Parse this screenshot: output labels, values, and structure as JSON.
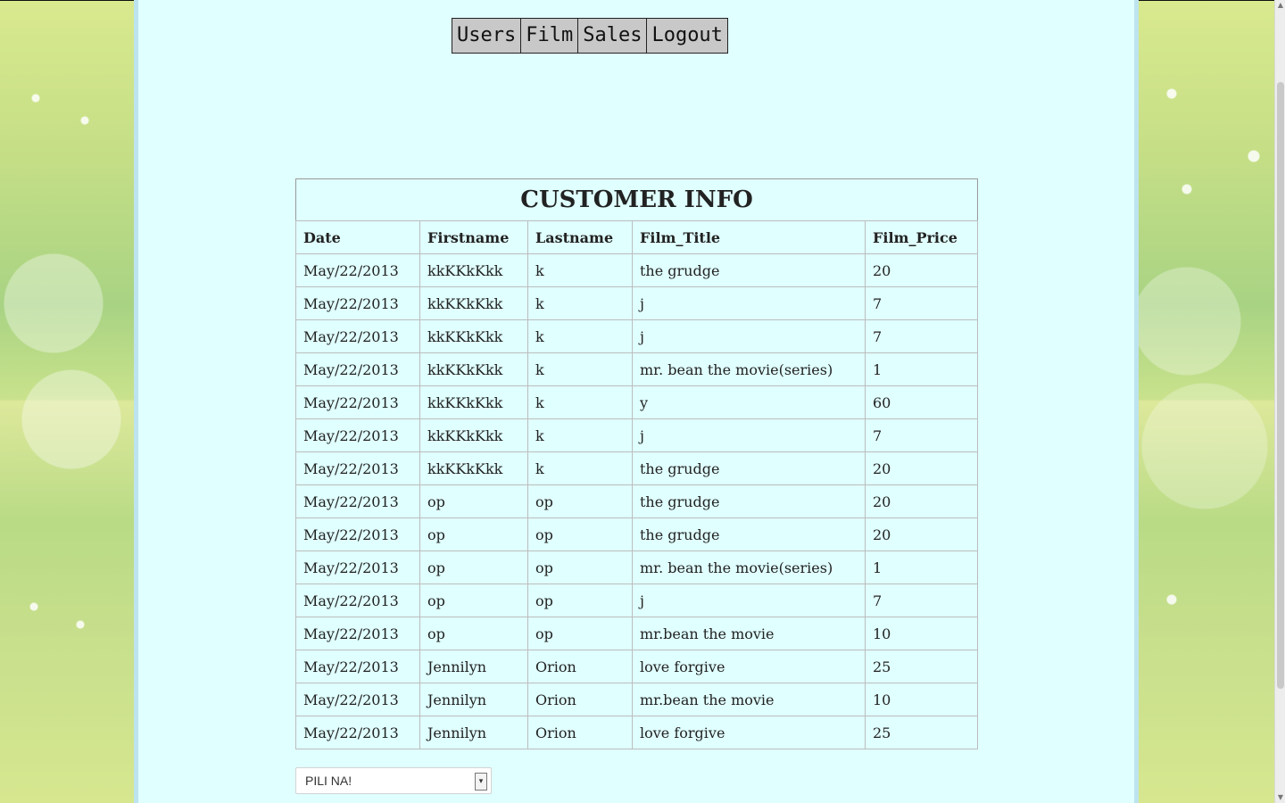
{
  "nav": {
    "items": [
      {
        "label": "Users"
      },
      {
        "label": "Film"
      },
      {
        "label": "Sales"
      },
      {
        "label": "Logout"
      }
    ]
  },
  "table": {
    "title": "CUSTOMER INFO",
    "columns": [
      "Date",
      "Firstname",
      "Lastname",
      "Film_Title",
      "Film_Price"
    ],
    "rows": [
      [
        "May/22/2013",
        "kkKKkKkk",
        "k",
        "the grudge",
        "20"
      ],
      [
        "May/22/2013",
        "kkKKkKkk",
        "k",
        "j",
        "7"
      ],
      [
        "May/22/2013",
        "kkKKkKkk",
        "k",
        "j",
        "7"
      ],
      [
        "May/22/2013",
        "kkKKkKkk",
        "k",
        "mr. bean the movie(series)",
        "1"
      ],
      [
        "May/22/2013",
        "kkKKkKkk",
        "k",
        "y",
        "60"
      ],
      [
        "May/22/2013",
        "kkKKkKkk",
        "k",
        "j",
        "7"
      ],
      [
        "May/22/2013",
        "kkKKkKkk",
        "k",
        "the grudge",
        "20"
      ],
      [
        "May/22/2013",
        "op",
        "op",
        "the grudge",
        "20"
      ],
      [
        "May/22/2013",
        "op",
        "op",
        "the grudge",
        "20"
      ],
      [
        "May/22/2013",
        "op",
        "op",
        "mr. bean the movie(series)",
        "1"
      ],
      [
        "May/22/2013",
        "op",
        "op",
        "j",
        "7"
      ],
      [
        "May/22/2013",
        "op",
        "op",
        "mr.bean the movie",
        "10"
      ],
      [
        "May/22/2013",
        "Jennilyn",
        "Orion",
        "love forgive",
        "25"
      ],
      [
        "May/22/2013",
        "Jennilyn",
        "Orion",
        "mr.bean the movie",
        "10"
      ],
      [
        "May/22/2013",
        "Jennilyn",
        "Orion",
        "love forgive",
        "25"
      ]
    ]
  },
  "select": {
    "selected": "PILI NA!"
  },
  "icons": {
    "scroll_up": "scroll-up-arrow-icon",
    "scroll_down": "scroll-down-arrow-icon",
    "dropdown": "dropdown-arrow-icon"
  }
}
